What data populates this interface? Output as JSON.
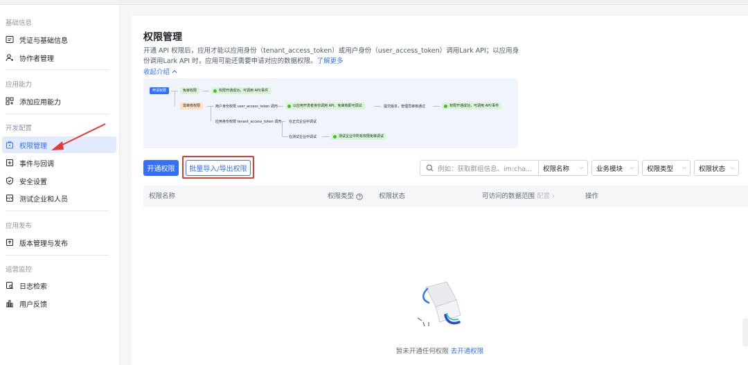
{
  "sidebar": {
    "sections": [
      {
        "title": "基础信息",
        "items": [
          {
            "label": "凭证与基础信息",
            "icon": "id-card-icon"
          },
          {
            "label": "协作者管理",
            "icon": "user-add-icon"
          }
        ]
      },
      {
        "title": "应用能力",
        "items": [
          {
            "label": "添加应用能力",
            "icon": "app-grid-icon"
          }
        ]
      },
      {
        "title": "开发配置",
        "items": [
          {
            "label": "权限管理",
            "icon": "lock-icon",
            "active": true
          },
          {
            "label": "事件与回调",
            "icon": "event-icon"
          },
          {
            "label": "安全设置",
            "icon": "shield-icon"
          },
          {
            "label": "测试企业和人员",
            "icon": "test-icon"
          }
        ]
      },
      {
        "title": "应用发布",
        "items": [
          {
            "label": "版本管理与发布",
            "icon": "upload-icon"
          }
        ]
      },
      {
        "title": "运营监控",
        "items": [
          {
            "label": "日志检索",
            "icon": "log-search-icon"
          },
          {
            "label": "用户反馈",
            "icon": "feedback-icon"
          }
        ]
      }
    ]
  },
  "main": {
    "title": "权限管理",
    "description": "开通 API 权限后，应用才能以应用身份（tenant_access_token）或用户身份（user_access_token）调用Lark API；以应用身份调用Lark API 时，应用可能还需要申请对应的数据权限。",
    "learn_more": "了解更多",
    "collapse": "收起介绍",
    "flow": {
      "start": "申请权限",
      "no_review": "免审权限",
      "no_review_result": "权限开通成功，可调用 API/事件",
      "review": "需审核权限",
      "user_identity": "用户身份权限 user_access_token 调用",
      "user_result": "以应用开发者身份调用 API，免审核即可调试",
      "submit": "提交版本，管理员审核通过",
      "final_result": "权限开通成功，可调用 API/事件",
      "app_identity": "应用身份权限 tenant_access_token 调用",
      "formal": "在正式企业中调试",
      "test": "在测试企业中调试",
      "test_result": "测试企业中所有权限免审调试"
    },
    "toolbar": {
      "enable_btn": "开通权限",
      "batch_btn": "批量导入/导出权限",
      "search_placeholder": "例如：获取群组信息、im:cha...",
      "filters": [
        "权限名称",
        "业务模块",
        "权限类型",
        "权限状态"
      ]
    },
    "table": {
      "headers": {
        "name": "权限名称",
        "type": "权限类型",
        "status": "权限状态",
        "scope": "可访问的数据范围",
        "scope_config": "配置",
        "action": "操作"
      }
    },
    "empty": {
      "text": "暂未开通任何权限",
      "link": "去开通权限"
    }
  },
  "colors": {
    "accent": "#3370ff",
    "highlight": "#e53935",
    "active_bg": "#e1eaff"
  }
}
